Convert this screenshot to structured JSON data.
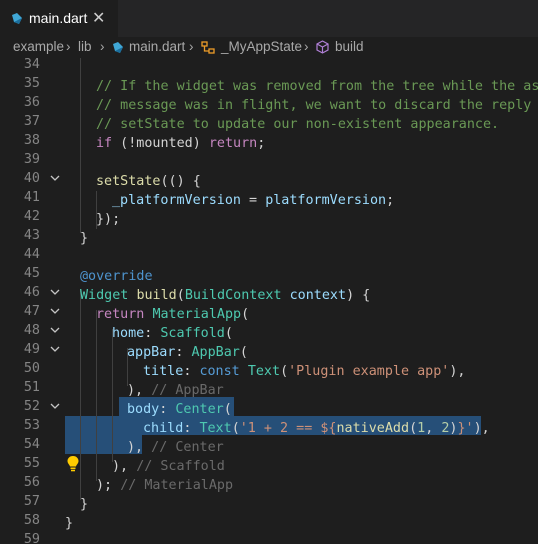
{
  "tab": {
    "title": "main.dart",
    "close": "✕"
  },
  "breadcrumb": {
    "items": [
      "example",
      "lib",
      "main.dart",
      "_MyAppState",
      "build"
    ],
    "sep": "›"
  },
  "editor": {
    "lines": [
      {
        "n": "34",
        "fold": ""
      },
      {
        "n": "35",
        "fold": ""
      },
      {
        "n": "36",
        "fold": ""
      },
      {
        "n": "37",
        "fold": ""
      },
      {
        "n": "38",
        "fold": ""
      },
      {
        "n": "39",
        "fold": ""
      },
      {
        "n": "40",
        "fold": "v"
      },
      {
        "n": "41",
        "fold": ""
      },
      {
        "n": "42",
        "fold": ""
      },
      {
        "n": "43",
        "fold": ""
      },
      {
        "n": "44",
        "fold": ""
      },
      {
        "n": "45",
        "fold": ""
      },
      {
        "n": "46",
        "fold": "v"
      },
      {
        "n": "47",
        "fold": "v"
      },
      {
        "n": "48",
        "fold": "v"
      },
      {
        "n": "49",
        "fold": "v"
      },
      {
        "n": "50",
        "fold": ""
      },
      {
        "n": "51",
        "fold": ""
      },
      {
        "n": "52",
        "fold": "v"
      },
      {
        "n": "53",
        "fold": ""
      },
      {
        "n": "54",
        "fold": ""
      },
      {
        "n": "55",
        "fold": ""
      },
      {
        "n": "56",
        "fold": ""
      },
      {
        "n": "57",
        "fold": ""
      },
      {
        "n": "58",
        "fold": ""
      },
      {
        "n": "59",
        "fold": ""
      }
    ],
    "code": {
      "l35": "// If the widget was removed from the tree while the async",
      "l36": "// message was in flight, we want to discard the reply rat",
      "l37": "// setState to update our non-existent appearance.",
      "l38a": "if",
      "l38b": " (!mounted) ",
      "l38c": "return",
      "l38d": ";",
      "l40a": "setState",
      "l40b": "(() {",
      "l41a": "_platformVersion",
      "l41b": " = ",
      "l41c": "platformVersion",
      "l41d": ";",
      "l42": "});",
      "l43": "}",
      "l45": "@override",
      "l46a": "Widget",
      "l46b": " ",
      "l46c": "build",
      "l46d": "(",
      "l46e": "BuildContext",
      "l46f": " ",
      "l46g": "context",
      "l46h": ") {",
      "l47a": "return",
      "l47b": " ",
      "l47c": "MaterialApp",
      "l47d": "(",
      "l48a": "home",
      "l48b": ": ",
      "l48c": "Scaffold",
      "l48d": "(",
      "l49a": "appBar",
      "l49b": ": ",
      "l49c": "AppBar",
      "l49d": "(",
      "l50a": "title",
      "l50b": ": ",
      "l50c": "const",
      "l50d": " ",
      "l50e": "Text",
      "l50f": "(",
      "l50g": "'Plugin example app'",
      "l50h": "),",
      "l51a": "), ",
      "l51b": "// AppBar",
      "l52a": "body",
      "l52b": ": ",
      "l52c": "Center",
      "l52d": "(",
      "l53a": "child",
      "l53b": ": ",
      "l53c": "Text",
      "l53d": "(",
      "l53e": "'1 + 2 == ${",
      "l53f": "nativeAdd",
      "l53g": "(",
      "l53h": "1",
      "l53i": ", ",
      "l53j": "2",
      "l53k": ")",
      "l53l": "}'",
      "l53m": "),",
      "l54a": "),",
      "l54b": " // Center",
      "l55a": "), ",
      "l55b": "// Scaffold",
      "l56a": "); ",
      "l56b": "// MaterialApp",
      "l57": "}",
      "l58": "}"
    }
  },
  "colors": {
    "bg": "#1e1e1e",
    "selection": "#264f78",
    "comment": "#6a9955",
    "keyword": "#c586c0",
    "type": "#4ec9b0",
    "function": "#dcdcaa",
    "variable": "#9cdcfe",
    "string": "#ce9178"
  }
}
